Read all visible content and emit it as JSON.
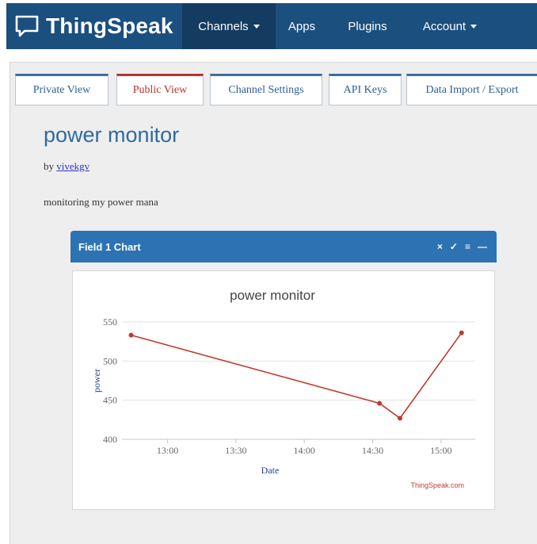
{
  "navbar": {
    "brand": "ThingSpeak",
    "items": [
      {
        "label": "Channels",
        "dropdown": true,
        "active": true
      },
      {
        "label": "Apps",
        "dropdown": false,
        "active": false
      },
      {
        "label": "Plugins",
        "dropdown": false,
        "active": false
      },
      {
        "label": "Account",
        "dropdown": true,
        "active": false
      }
    ]
  },
  "tabs": [
    {
      "label": "Private View",
      "active": false
    },
    {
      "label": "Public View",
      "active": true
    },
    {
      "label": "Channel Settings",
      "active": false
    },
    {
      "label": "API Keys",
      "active": false
    },
    {
      "label": "Data Import / Export",
      "active": false
    }
  ],
  "channel": {
    "title": "power monitor",
    "by_prefix": "by",
    "author": "vivekgv",
    "description": "monitoring my power mana"
  },
  "widget": {
    "title": "Field 1 Chart",
    "tools": [
      "×",
      "✓",
      "≡",
      "—"
    ]
  },
  "chart_data": {
    "type": "line",
    "title": "power monitor",
    "xlabel": "Date",
    "ylabel": "power",
    "credit": "ThingSpeak.com",
    "x_ticks": [
      "13:00",
      "13:30",
      "14:00",
      "14:30",
      "15:00"
    ],
    "y_ticks": [
      550,
      500,
      450,
      400
    ],
    "ylim": [
      400,
      560
    ],
    "xlim": [
      "12:40",
      "15:15"
    ],
    "grid": true,
    "series": [
      {
        "color": "#c0392b",
        "points": [
          {
            "x": "12:44",
            "y": 533
          },
          {
            "x": "14:33",
            "y": 446
          },
          {
            "x": "14:42",
            "y": 427
          },
          {
            "x": "15:09",
            "y": 536
          }
        ]
      }
    ]
  },
  "colors": {
    "navbar": "#1b4f7e",
    "widget_header": "#2d73b3",
    "series": "#c0392b",
    "active_tab": "#b8322e"
  }
}
